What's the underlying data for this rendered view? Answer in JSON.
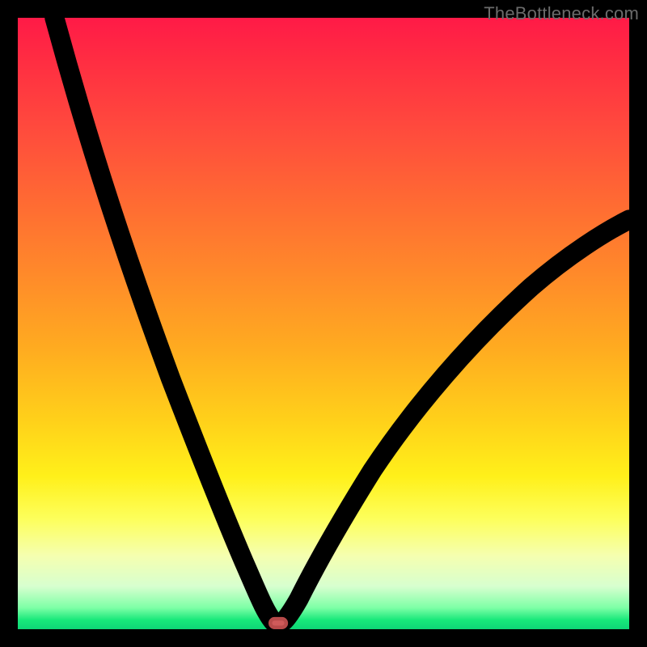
{
  "watermark": "TheBottleneck.com",
  "colors": {
    "page_bg": "#000000",
    "curve_stroke": "#000000",
    "min_marker_fill": "#cf5a5a",
    "min_marker_stroke": "#b84a4a",
    "watermark_text": "#6b6b6b",
    "gradient_top": "#ff1a47",
    "gradient_mid": "#ffd11a",
    "gradient_bottom": "#0ed576"
  },
  "chart_data": {
    "type": "line",
    "title": "",
    "xlabel": "",
    "ylabel": "",
    "xlim": [
      0,
      100
    ],
    "ylim": [
      0,
      100
    ],
    "grid": false,
    "legend": false,
    "annotations": {
      "watermark": "TheBottleneck.com",
      "minimum_marker": {
        "x": 42.5,
        "y": 0.6
      }
    },
    "series": [
      {
        "name": "bottleneck_curve",
        "x": [
          6,
          10,
          15,
          20,
          25,
          30,
          34,
          37,
          40,
          42,
          44,
          48,
          54,
          60,
          68,
          78,
          90,
          100
        ],
        "y": [
          100,
          86,
          70,
          55,
          41,
          28,
          18,
          11,
          5,
          1,
          1.5,
          6,
          14,
          23,
          34,
          46,
          58,
          67
        ]
      }
    ]
  }
}
